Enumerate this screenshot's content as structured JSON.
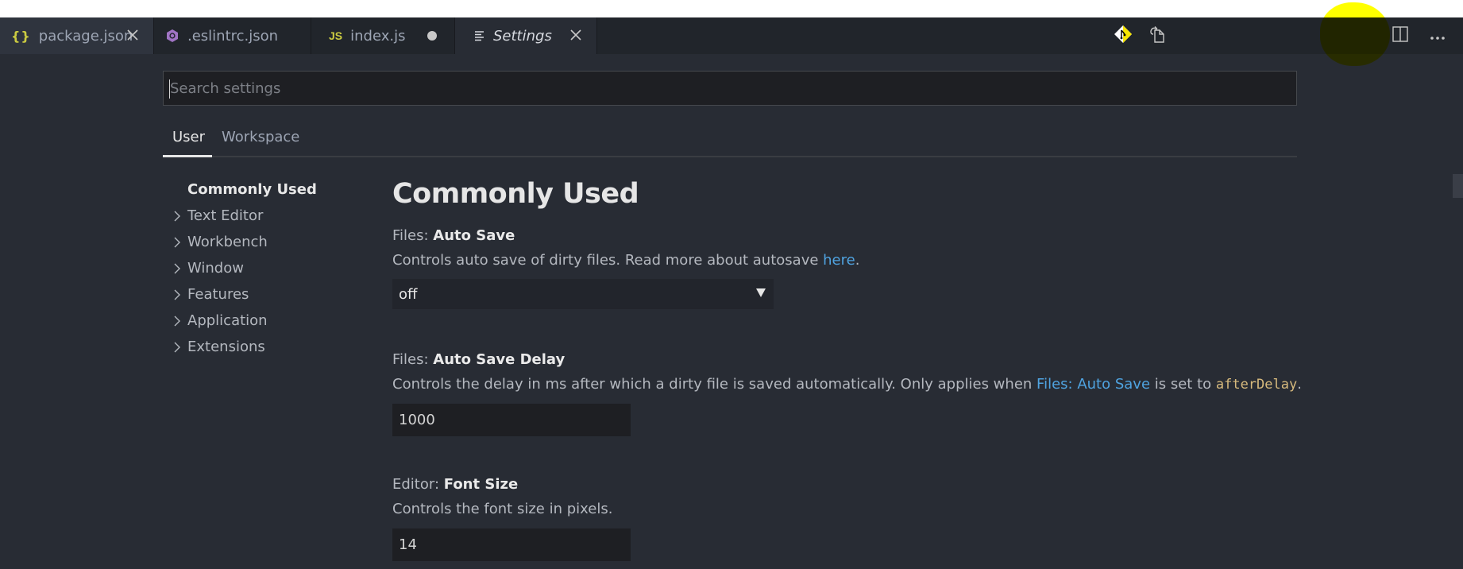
{
  "tabs": [
    {
      "label": "package.json",
      "icon": "json-braces-icon",
      "icon_text": "{}",
      "state": "close"
    },
    {
      "label": ".eslintrc.json",
      "icon": "eslint-icon",
      "state": "none"
    },
    {
      "label": "index.js",
      "icon": "javascript-icon",
      "icon_text": "JS",
      "state": "dirty"
    },
    {
      "label": "Settings",
      "icon": "settings-lines-icon",
      "state": "close",
      "active": true
    }
  ],
  "editor_actions": [
    "git-compare-icon",
    "open-file-icon",
    "split-editor-icon",
    "more-actions-icon"
  ],
  "search": {
    "placeholder": "Search settings",
    "value": ""
  },
  "scope_tabs": [
    {
      "label": "User",
      "active": true
    },
    {
      "label": "Workspace",
      "active": false
    }
  ],
  "tree": [
    {
      "label": "Commonly Used",
      "expandable": false,
      "active": true
    },
    {
      "label": "Text Editor",
      "expandable": true
    },
    {
      "label": "Workbench",
      "expandable": true
    },
    {
      "label": "Window",
      "expandable": true
    },
    {
      "label": "Features",
      "expandable": true
    },
    {
      "label": "Application",
      "expandable": true
    },
    {
      "label": "Extensions",
      "expandable": true
    }
  ],
  "section_title": "Commonly Used",
  "settings": {
    "auto_save": {
      "category": "Files: ",
      "name": "Auto Save",
      "desc_before": "Controls auto save of dirty files. Read more about autosave ",
      "desc_link": "here",
      "desc_after": ".",
      "value": "off"
    },
    "auto_save_delay": {
      "category": "Files: ",
      "name": "Auto Save Delay",
      "desc_before": "Controls the delay in ms after which a dirty file is saved automatically. Only applies when ",
      "desc_link": "Files: Auto Save",
      "desc_mid": " is set to ",
      "desc_code": "afterDelay",
      "desc_after": ".",
      "value": "1000"
    },
    "font_size": {
      "category": "Editor: ",
      "name": "Font Size",
      "desc": "Controls the font size in pixels.",
      "value": "14"
    }
  },
  "colors": {
    "editor_bg": "#282c34",
    "tabbar_bg": "#21252b",
    "link": "#4fa3e0",
    "code": "#d7ba7d",
    "highlight": "#ffff00"
  }
}
